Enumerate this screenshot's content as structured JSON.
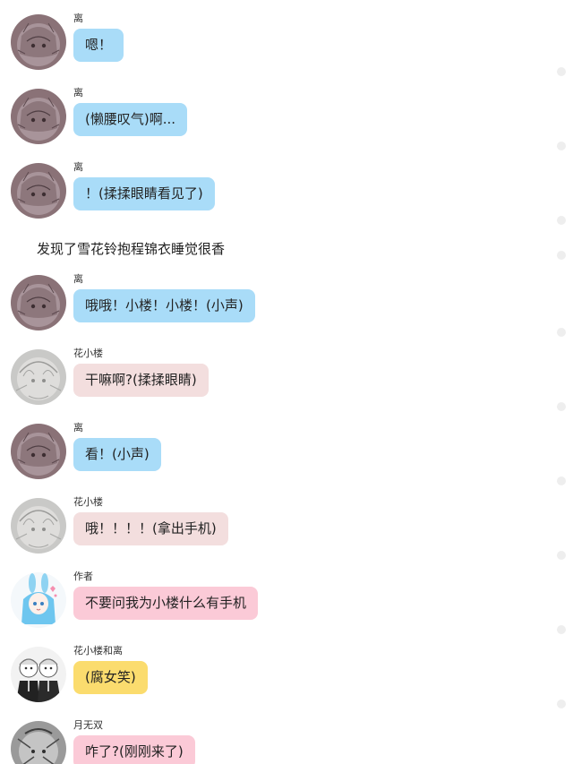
{
  "messages": [
    {
      "name": "离",
      "text": "嗯！",
      "bubble_color": "#a9dcf8"
    },
    {
      "name": "离",
      "text": "(懒腰叹气)啊...",
      "bubble_color": "#a9dcf8"
    },
    {
      "name": "离",
      "text": "！(揉揉眼睛看见了)",
      "bubble_color": "#a9dcf8"
    },
    {
      "name": "离",
      "text": "哦哦！小楼！小楼！(小声)",
      "bubble_color": "#a9dcf8"
    },
    {
      "name": "花小楼",
      "text": "干嘛啊?(揉揉眼睛)",
      "bubble_color": "#f3dede"
    },
    {
      "name": "离",
      "text": "看！(小声)",
      "bubble_color": "#a9dcf8"
    },
    {
      "name": "花小楼",
      "text": "哦！！！！(拿出手机)",
      "bubble_color": "#f3dede"
    },
    {
      "name": "作者",
      "text": "不要问我为小楼什么有手机",
      "bubble_color": "#fbcad7"
    },
    {
      "name": "花小楼和离",
      "text": "(腐女笑)",
      "bubble_color": "#fbdc6e"
    },
    {
      "name": "月无双",
      "text": "咋了?(刚刚来了)",
      "bubble_color": "#fbcad7"
    }
  ],
  "narration": "发现了雪花铃抱程锦衣睡觉很香",
  "avatar_icons": {
    "li": "sketch-girl-dark-avatar",
    "hua": "sketch-girl-grey-avatar",
    "author": "blue-bunny-girl-avatar",
    "pair": "two-characters-avatar",
    "yue": "sketch-mono-avatar"
  }
}
